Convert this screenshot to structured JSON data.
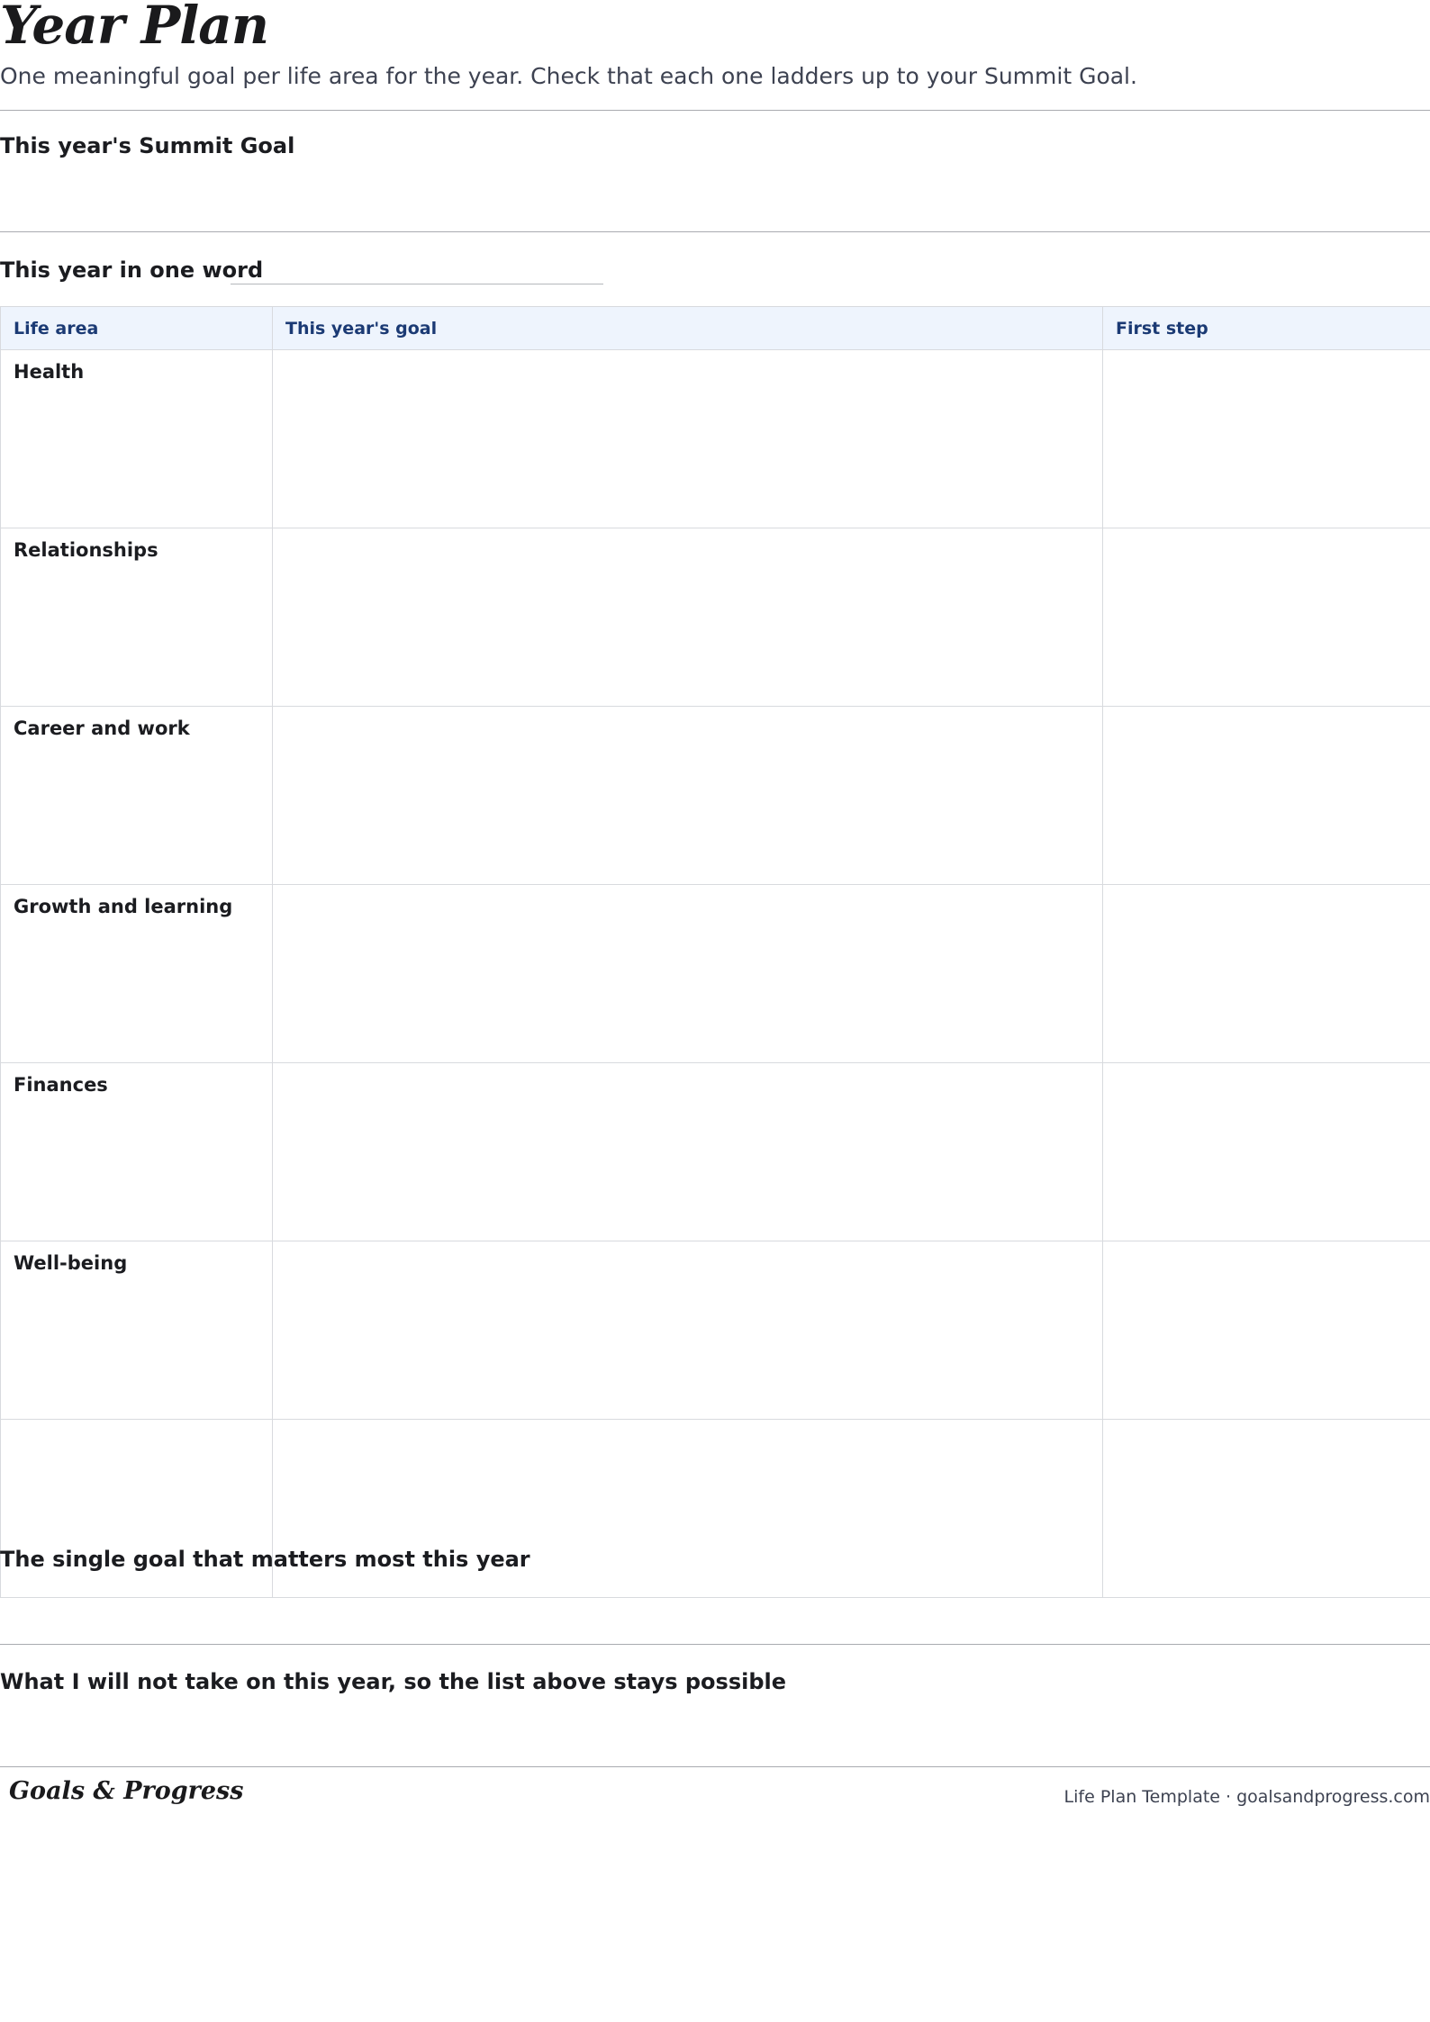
{
  "header": {
    "title": "Year Plan",
    "subtitle": "One meaningful goal per life area for the year. Check that each one ladders up to your Summit Goal."
  },
  "summit": {
    "label": "This year's Summit Goal"
  },
  "one_word": {
    "label": "This year in one word"
  },
  "table": {
    "columns": [
      "Life area",
      "This year's goal",
      "First step"
    ],
    "rows": [
      {
        "area": "Health"
      },
      {
        "area": "Relationships"
      },
      {
        "area": "Career and work"
      },
      {
        "area": "Growth and learning"
      },
      {
        "area": "Finances"
      },
      {
        "area": "Well-being"
      },
      {
        "area": ""
      }
    ]
  },
  "single_goal": {
    "label": "The single goal that matters most this year"
  },
  "not_taking": {
    "label": "What I will not take on this year, so the list above stays possible"
  },
  "footer": {
    "brand": "Goals & Progress",
    "meta": "Life Plan Template · goalsandprogress.com"
  }
}
